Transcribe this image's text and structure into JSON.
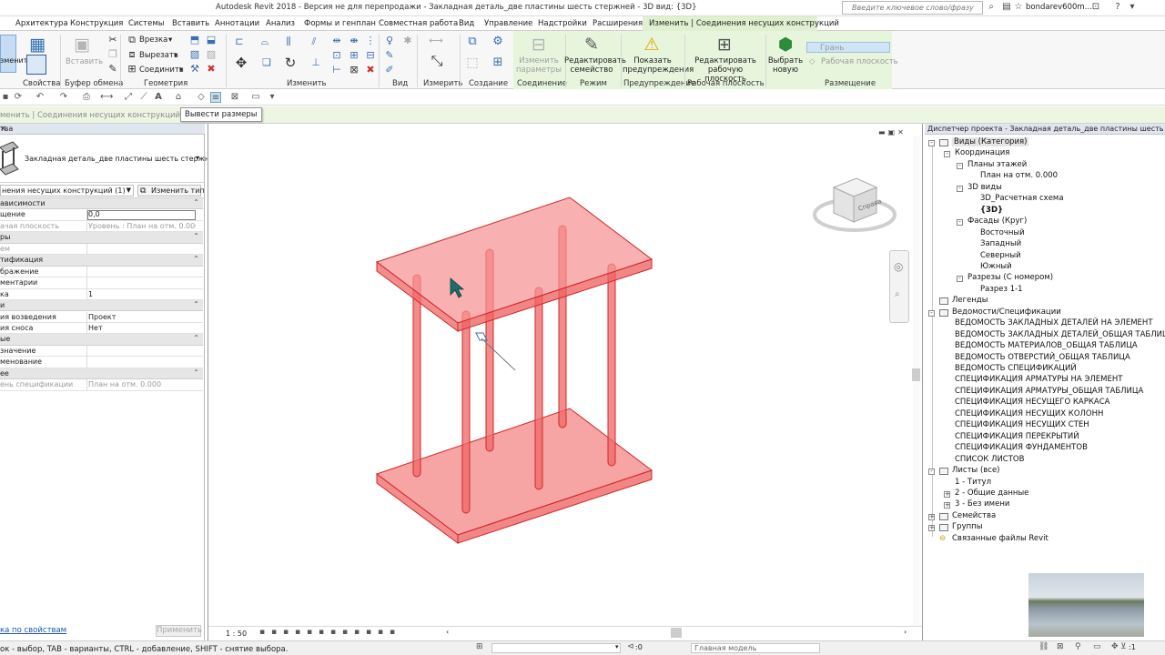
{
  "window": {
    "title": "Autodesk Revit 2018 - Версия не для перепродажи -    Закладная деталь_две пластины шесть стержней - 3D вид: {3D}",
    "search_placeholder": "Введите ключевое слово/фразу",
    "user": "bondarev600m..."
  },
  "ribbon_tabs": [
    "Архитектура",
    "Конструкция",
    "Системы",
    "Вставить",
    "Аннотации",
    "Анализ",
    "Формы и генплан",
    "Совместная работа",
    "Вид",
    "Управление",
    "Надстройки",
    "Расширения",
    "Изменить | Соединения несущих конструкций"
  ],
  "ribbon": {
    "modify_label": "зменить",
    "properties_label": "Свойства",
    "clipboard": {
      "paste": "Вставить",
      "label": "Буфер обмена"
    },
    "geometry": {
      "cut": "Врезка",
      "cut_out": "Вырезать",
      "join": "Соединить",
      "label": "Геометрия"
    },
    "modify_group_label": "Изменить",
    "view_group_label": "Вид",
    "measure_group_label": "Измерить",
    "create_group_label": "Создание",
    "connection": {
      "label": "Соединение",
      "btn": "Изменить\nпараметры"
    },
    "mode": {
      "label": "Режим",
      "btn": "Редактировать\nсемейство"
    },
    "warnings": {
      "label": "Предупреждение",
      "btn": "Показать\nпредупреждения"
    },
    "workplane": {
      "label": "Рабочая плоскость",
      "btn": "Редактировать\nрабочую плоскость"
    },
    "placement": {
      "label": "Размещение",
      "pick": "Выбрать\nновую",
      "face": "Грань",
      "wp": "Рабочая плоскость"
    }
  },
  "tooltip": "Вывести размеры",
  "options_bar": "менить | Соединения несущих конструкций",
  "properties": {
    "header": "тва",
    "type_name": "Закладная деталь_две пластины шесть стержней",
    "instance_selector": "нения несущих конструкций (1)",
    "edit_type": "Изменить тип",
    "rows": [
      {
        "kind": "sec",
        "name": "ависимости",
        "value": ""
      },
      {
        "kind": "row",
        "name": "щение",
        "value": "0,0",
        "editing": true
      },
      {
        "kind": "row",
        "name": "ачая плоскость",
        "value": "Уровень : План на отм. 0.000",
        "grey": true
      },
      {
        "kind": "sec",
        "name": "ры",
        "value": ""
      },
      {
        "kind": "row",
        "name": "ем",
        "value": "",
        "grey": true
      },
      {
        "kind": "sec",
        "name": "тификация",
        "value": ""
      },
      {
        "kind": "row",
        "name": "бражение",
        "value": ""
      },
      {
        "kind": "row",
        "name": "ментарии",
        "value": ""
      },
      {
        "kind": "row",
        "name": "ка",
        "value": "1"
      },
      {
        "kind": "sec",
        "name": "и",
        "value": ""
      },
      {
        "kind": "row",
        "name": "ия возведения",
        "value": "Проект"
      },
      {
        "kind": "row",
        "name": "ия сноса",
        "value": "Нет"
      },
      {
        "kind": "sec",
        "name": "ые",
        "value": ""
      },
      {
        "kind": "row",
        "name": "значение",
        "value": ""
      },
      {
        "kind": "row",
        "name": "менование",
        "value": ""
      },
      {
        "kind": "sec",
        "name": "ее",
        "value": ""
      },
      {
        "kind": "row",
        "name": "ень спецификации",
        "value": "План на отм. 0.000",
        "grey": true
      }
    ],
    "help_link": "ка по свойствам",
    "apply": "Применить"
  },
  "view": {
    "scale": "1 : 50",
    "viewcube_face": "Справа"
  },
  "browser": {
    "header": "Диспетчер проекта - Закладная деталь_две пластины шесть стержней",
    "nodes": [
      {
        "label": "Виды (Категория)",
        "level": 0,
        "toggle": "-",
        "icon": true,
        "highlight": true
      },
      {
        "label": "Координация",
        "level": 1,
        "toggle": "-"
      },
      {
        "label": "Планы этажей",
        "level": 2,
        "toggle": "-"
      },
      {
        "label": "План на отм. 0.000",
        "level": 3
      },
      {
        "label": "3D виды",
        "level": 2,
        "toggle": "-"
      },
      {
        "label": "3D_Расчетная схема",
        "level": 3
      },
      {
        "label": "{3D}",
        "level": 3,
        "bold": true
      },
      {
        "label": "Фасады (Круг)",
        "level": 2,
        "toggle": "-"
      },
      {
        "label": "Восточный",
        "level": 3
      },
      {
        "label": "Западный",
        "level": 3
      },
      {
        "label": "Северный",
        "level": 3
      },
      {
        "label": "Южный",
        "level": 3
      },
      {
        "label": "Разрезы (С номером)",
        "level": 2,
        "toggle": "-"
      },
      {
        "label": "Разрез 1-1",
        "level": 3
      },
      {
        "label": "Легенды",
        "level": 0,
        "icon": true
      },
      {
        "label": "Ведомости/Спецификации",
        "level": 0,
        "toggle": "-",
        "icon": true
      },
      {
        "label": "ВЕДОМОСТЬ ЗАКЛАДНЫХ ДЕТАЛЕЙ НА ЭЛЕМЕНТ",
        "level": 1
      },
      {
        "label": "ВЕДОМОСТЬ ЗАКЛАДНЫХ ДЕТАЛЕЙ_ОБЩАЯ ТАБЛИЦА",
        "level": 1
      },
      {
        "label": "ВЕДОМОСТЬ МАТЕРИАЛОВ_ОБЩАЯ ТАБЛИЦА",
        "level": 1
      },
      {
        "label": "ВЕДОМОСТЬ ОТВЕРСТИЙ_ОБЩАЯ ТАБЛИЦА",
        "level": 1
      },
      {
        "label": "ВЕДОМОСТЬ СПЕЦИФИКАЦИЙ",
        "level": 1
      },
      {
        "label": "СПЕЦИФИКАЦИЯ АРМАТУРЫ НА ЭЛЕМЕНТ",
        "level": 1
      },
      {
        "label": "СПЕЦИФИКАЦИЯ АРМАТУРЫ_ОБЩАЯ ТАБЛИЦА",
        "level": 1
      },
      {
        "label": "СПЕЦИФИКАЦИЯ НЕСУЩЕГО КАРКАСА",
        "level": 1
      },
      {
        "label": "СПЕЦИФИКАЦИЯ НЕСУЩИХ КОЛОНН",
        "level": 1
      },
      {
        "label": "СПЕЦИФИКАЦИЯ НЕСУЩИХ СТЕН",
        "level": 1
      },
      {
        "label": "СПЕЦИФИКАЦИЯ ПЕРЕКРЫТИЙ",
        "level": 1
      },
      {
        "label": "СПЕЦИФИКАЦИЯ ФУНДАМЕНТОВ",
        "level": 1
      },
      {
        "label": "СПИСОК ЛИСТОВ",
        "level": 1
      },
      {
        "label": "Листы (все)",
        "level": 0,
        "toggle": "-",
        "icon": true
      },
      {
        "label": "1 - Титул",
        "level": 1
      },
      {
        "label": "2 - Общие данные",
        "level": 1,
        "toggle": "+"
      },
      {
        "label": "3 - Без имени",
        "level": 1,
        "toggle": "+"
      },
      {
        "label": "Семейства",
        "level": 0,
        "toggle": "+",
        "icon": true
      },
      {
        "label": "Группы",
        "level": 0,
        "toggle": "+",
        "icon": true
      },
      {
        "label": "Связанные файлы Revit",
        "level": 0,
        "link": true
      }
    ]
  },
  "status": {
    "hint": "ок - выбор, TAB - варианты, CTRL - добавление, SHIFT - снятие выбора.",
    "zero": ":0",
    "model": "Главная модель",
    "selected": ":1"
  },
  "colors": {
    "accent_green": "#dff1cf",
    "solid_fill": "#f47b7b",
    "solid_edge": "#d02828"
  },
  "icons": [
    "info-icon",
    "star-icon",
    "help-icon",
    "user-icon",
    "minimize-icon",
    "close-icon",
    "cursor-icon"
  ]
}
